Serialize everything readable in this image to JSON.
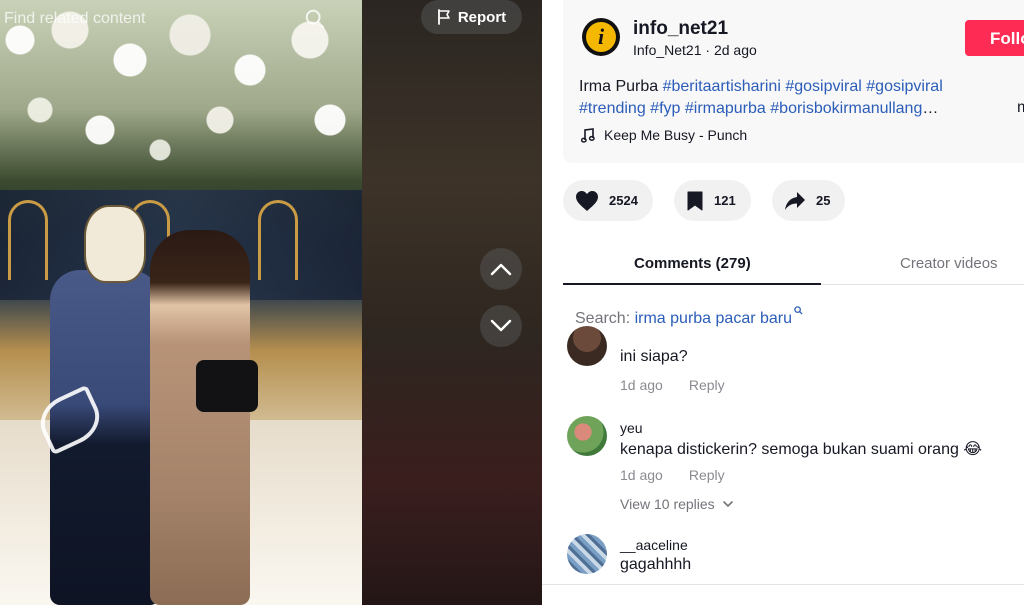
{
  "video": {
    "find_related": "Find related content",
    "report_label": "Report"
  },
  "author": {
    "name": "info_net21",
    "handle": "Info_Net21",
    "separator": " · ",
    "time": "2d ago",
    "follow_label": "Follow"
  },
  "caption": {
    "text": "Irma Purba ",
    "hashtags": [
      "#beritaartisharini",
      "#gosipviral",
      "#gosipviral",
      "#trending",
      "#fyp",
      "#irmapurba",
      "#borisbokirmanullang"
    ],
    "ellipsis": "…",
    "more": "m"
  },
  "music": {
    "title": "Keep Me Busy - Punch"
  },
  "actions": {
    "likes": "2524",
    "saves": "121",
    "shares": "25"
  },
  "tabs": {
    "comments": "Comments (279)",
    "creator_videos": "Creator videos"
  },
  "search_related": {
    "prefix": "Search: ",
    "query": "irma purba pacar baru"
  },
  "comments": [
    {
      "user": "",
      "text": "ini siapa?",
      "time": "1d ago",
      "reply": "Reply"
    },
    {
      "user": "yeu",
      "text": "kenapa distickerin? semoga bukan suami orang",
      "emoji": "😂",
      "time": "1d ago",
      "reply": "Reply",
      "view_replies": "View 10 replies"
    },
    {
      "user": "__aaceline",
      "text": "gagahhhh"
    }
  ],
  "colors": {
    "accent_red": "#fe2c55",
    "hashtag_blue": "#2b5db9"
  }
}
